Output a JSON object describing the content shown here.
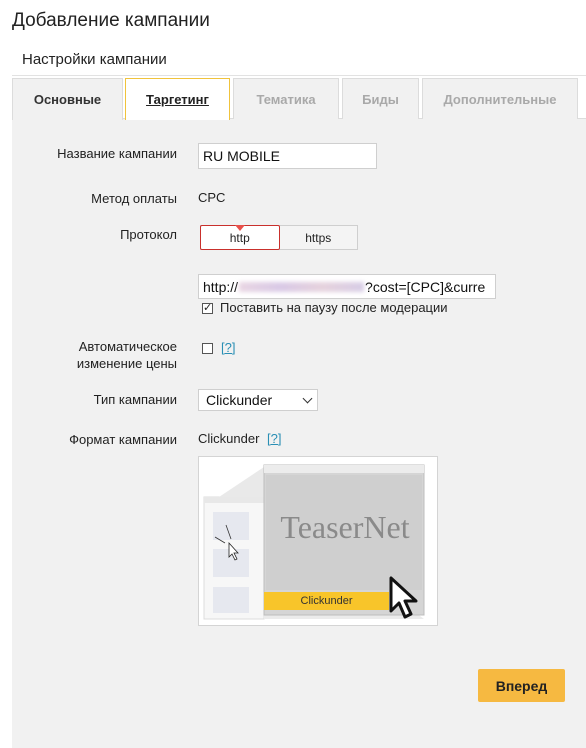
{
  "page_title": "Добавление кампании",
  "section_title": "Настройки кампании",
  "tabs": [
    {
      "label": "Основные",
      "state": "active"
    },
    {
      "label": "Таргетинг",
      "state": "highlight"
    },
    {
      "label": "Тематика",
      "state": "inactive"
    },
    {
      "label": "Биды",
      "state": "inactive"
    },
    {
      "label": "Дополнительные",
      "state": "inactive"
    }
  ],
  "form": {
    "campaign_name_label": "Название кампании",
    "campaign_name_value": "RU MOBILE",
    "payment_method_label": "Метод оплаты",
    "payment_method_value": "CPC",
    "protocol_label": "Протокол",
    "protocol_options": [
      "http",
      "https"
    ],
    "protocol_selected": "http",
    "url_prefix": "http://",
    "url_suffix": "?cost=[CPC]&curre",
    "pause_checkbox_label": "Поставить на паузу после модерации",
    "pause_checked": true,
    "auto_price_label_line1": "Автоматическое",
    "auto_price_label_line2": "изменение цены",
    "auto_price_checked": false,
    "help_link": "[?]",
    "campaign_type_label": "Тип кампании",
    "campaign_type_value": "Clickunder",
    "campaign_format_label": "Формат кампании",
    "campaign_format_value": "Clickunder"
  },
  "preview": {
    "brand": "TeaserNet",
    "button_label": "Clickunder"
  },
  "next_button": "Вперед",
  "colors": {
    "accent": "#f6b941",
    "link": "#2a8fb5",
    "panel_bg": "#f1f1f1",
    "protocol_border": "#c9302c"
  }
}
